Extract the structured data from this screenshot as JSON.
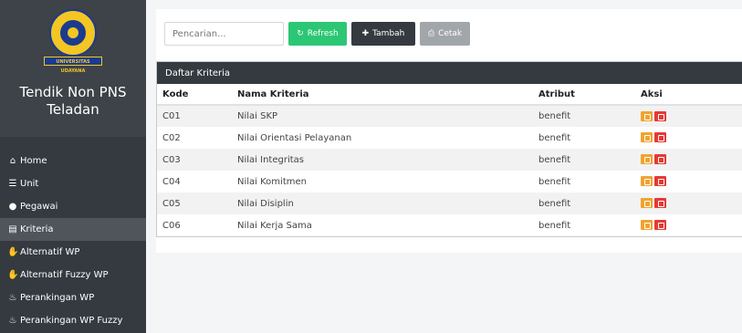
{
  "sidebar": {
    "logo_text": "UNIVERSITAS UDAYANA",
    "title_line1": "Tendik Non PNS",
    "title_line2": "Teladan",
    "items": [
      {
        "label": "Home",
        "icon": "home-icon",
        "active": false
      },
      {
        "label": "Unit",
        "icon": "server-icon",
        "active": false
      },
      {
        "label": "Pegawai",
        "icon": "user-icon",
        "active": false
      },
      {
        "label": "Kriteria",
        "icon": "list-icon",
        "active": true
      },
      {
        "label": "Alternatif WP",
        "icon": "hands-icon",
        "active": false
      },
      {
        "label": "Alternatif Fuzzy WP",
        "icon": "hands-icon",
        "active": false
      },
      {
        "label": "Perankingan WP",
        "icon": "fire-icon",
        "active": false
      },
      {
        "label": "Perankingan WP Fuzzy",
        "icon": "fire-icon",
        "active": false
      }
    ]
  },
  "toolbar": {
    "search_placeholder": "Pencarian...",
    "refresh_label": "Refresh",
    "tambah_label": "Tambah",
    "cetak_label": "Cetak"
  },
  "table": {
    "title": "Daftar Kriteria",
    "headers": [
      "Kode",
      "Nama Kriteria",
      "Atribut",
      "Aksi"
    ],
    "rows": [
      {
        "kode": "C01",
        "nama": "Nilai SKP",
        "atribut": "benefit"
      },
      {
        "kode": "C02",
        "nama": "Nilai Orientasi Pelayanan",
        "atribut": "benefit"
      },
      {
        "kode": "C03",
        "nama": "Nilai Integritas",
        "atribut": "benefit"
      },
      {
        "kode": "C04",
        "nama": "Nilai Komitmen",
        "atribut": "benefit"
      },
      {
        "kode": "C05",
        "nama": "Nilai Disiplin",
        "atribut": "benefit"
      },
      {
        "kode": "C06",
        "nama": "Nilai Kerja Sama",
        "atribut": "benefit"
      }
    ]
  },
  "colors": {
    "sidebar_bg": "#343a40",
    "refresh": "#2cc774",
    "tambah": "#343a40",
    "cetak": "#a1a6ab",
    "edit": "#f0a32f",
    "delete": "#e53935"
  }
}
